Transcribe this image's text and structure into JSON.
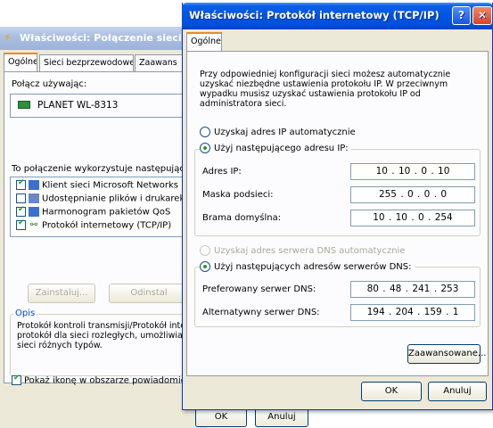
{
  "back_window": {
    "title": "Właściwości: Połączenie sieci be",
    "tabs": [
      "Ogólne",
      "Sieci bezprzewodowe",
      "Zaawans"
    ],
    "connect_using_label": "Połącz używając:",
    "adapter_name": "PLANET WL-8313",
    "components_label": "To połączenie wykorzystuje następujące s",
    "components": [
      {
        "label": "Klient sieci Microsoft Networks",
        "checked": true,
        "icon": "network-client-icon"
      },
      {
        "label": "Udostępnianie plików i drukarek",
        "checked": false,
        "icon": "file-sharing-icon"
      },
      {
        "label": "Harmonogram pakietów QoS",
        "checked": true,
        "icon": "qos-icon"
      },
      {
        "label": "Protokół internetowy (TCP/IP)",
        "checked": true,
        "icon": "protocol-icon"
      }
    ],
    "install_button": "Zainstaluj...",
    "uninstall_button": "Odinstal",
    "description_title": "Opis",
    "description_text": "Protokół kontroli transmisji/Protokół inte protokół dla sieci rozległych, umożliwiaj sieci różnych typów.",
    "show_icon_label": "Pokaż ikonę w obszarze powiadomień",
    "show_icon_checked": true,
    "ok_button": "OK",
    "cancel_button": "Anuluj"
  },
  "front_window": {
    "title": "Właściwości: Protokół internetowy (TCP/IP)",
    "help_glyph": "?",
    "close_glyph": "✕",
    "tab": "Ogólne",
    "description": "Przy odpowiedniej konfiguracji sieci możesz automatycznie uzyskać niezbędne ustawienia protokołu IP. W przeciwnym wypadku musisz uzyskać ustawienia protokołu IP od administratora sieci.",
    "auto_ip_label": "Uzyskaj adres IP automatycznie",
    "manual_ip_label": "Użyj następującego adresu IP:",
    "ip_address_label": "Adres IP:",
    "ip_address_value": "10 . 10 . 0 . 10",
    "subnet_label": "Maska podsieci:",
    "subnet_value": "255 . 0 . 0 . 0",
    "gateway_label": "Brama domyślna:",
    "gateway_value": "10 . 10 . 0 . 254",
    "auto_dns_label": "Uzyskaj adres serwera DNS automatycznie",
    "manual_dns_label": "Użyj następujących adresów serwerów DNS:",
    "preferred_dns_label": "Preferowany serwer DNS:",
    "preferred_dns_value": "80 . 48 . 241 . 253",
    "alternate_dns_label": "Alternatywny serwer DNS:",
    "alternate_dns_value": "194 . 204 . 159 . 1",
    "advanced_button": "Zaawansowane...",
    "ok_button": "OK",
    "cancel_button": "Anuluj"
  },
  "colors": {
    "title_bar_active": "#0054e3",
    "title_bar_inactive": "#9db3dc",
    "dialog_face": "#ece9d8",
    "tab_accent": "#e68b2c",
    "check_green": "#21a121"
  }
}
